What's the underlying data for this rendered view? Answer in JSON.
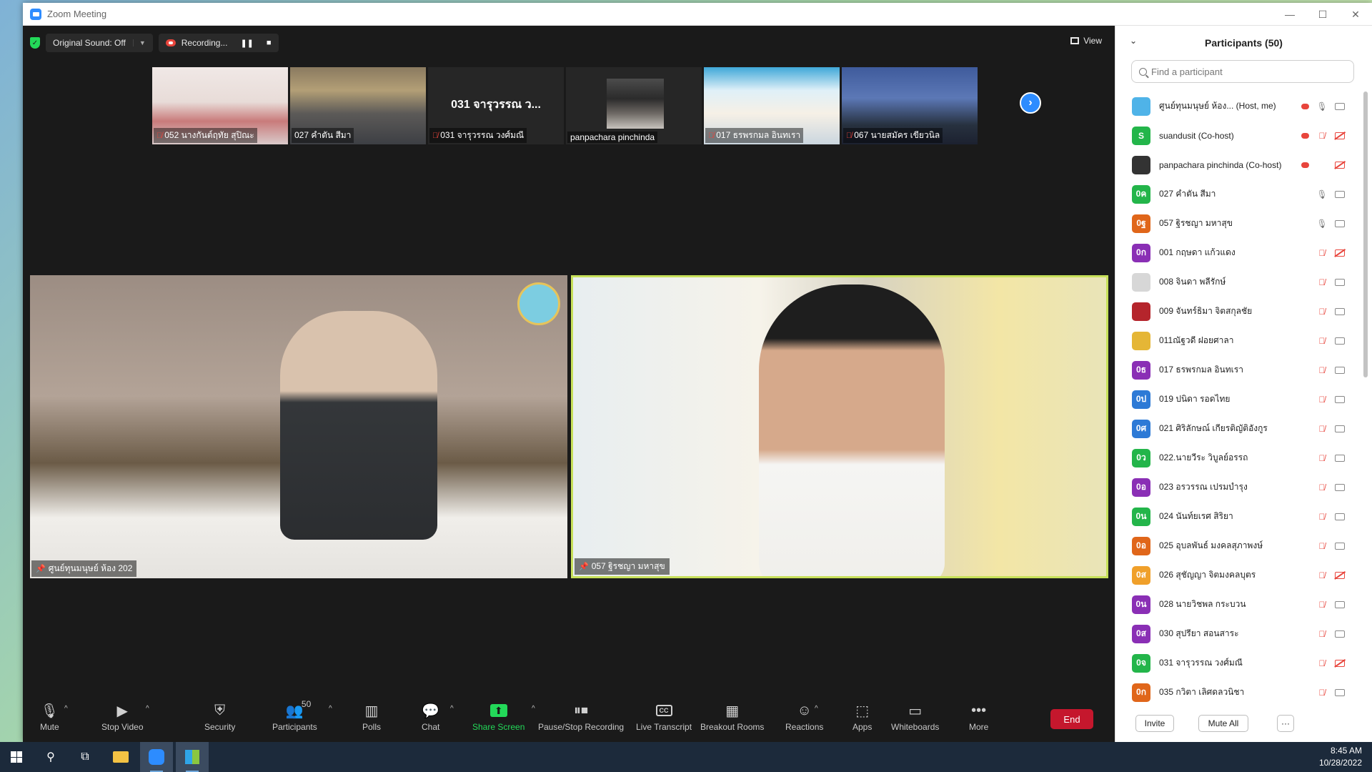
{
  "window": {
    "title": "Zoom Meeting",
    "controls": [
      "—",
      "☐",
      "✕"
    ]
  },
  "top_bar": {
    "original_sound": "Original Sound: Off",
    "recording": "Recording...",
    "pause_icon": "❚❚",
    "stop_icon": "■",
    "view": "View"
  },
  "thumbnails": [
    {
      "name": "052 นางกันต์ฤทัย  สุปิณะ",
      "muted": true
    },
    {
      "name": "027 คำตัน สีมา",
      "muted": false
    },
    {
      "name": "031 จารุวรรณ  วงศ์มณี",
      "muted": true,
      "big_label": "031 จารุวรรณ  ว..."
    },
    {
      "name": "panpachara pinchinda",
      "muted": false
    },
    {
      "name": "017 ธรพรกมล อินทเรา",
      "muted": true
    },
    {
      "name": "067 นายสมัคร  เขียวนิล",
      "muted": true
    }
  ],
  "next_icon": "›",
  "main_videos": [
    {
      "name": "ศูนย์ทุนมนุษย์ ห้อง 202"
    },
    {
      "name": "057 ฐิรชญา มหาสุข"
    }
  ],
  "toolbar": {
    "mute": "Mute",
    "stop_video": "Stop Video",
    "security": "Security",
    "participants": "Participants",
    "participants_count": "50",
    "polls": "Polls",
    "chat": "Chat",
    "share_screen": "Share Screen",
    "pause_stop_recording": "Pause/Stop Recording",
    "live_transcript": "Live Transcript",
    "cc": "CC",
    "breakout_rooms": "Breakout Rooms",
    "reactions": "Reactions",
    "apps": "Apps",
    "whiteboards": "Whiteboards",
    "more": "More",
    "end": "End"
  },
  "panel": {
    "title": "Participants (50)",
    "search_placeholder": "Find a participant",
    "invite": "Invite",
    "mute_all": "Mute All",
    "more": "···",
    "participants": [
      {
        "avatar": "",
        "color": "#4fb3e8",
        "name": "ศูนย์ทุนมนุษย์ ห้อง... (Host, me)",
        "rec": true,
        "mic": "on",
        "cam": "on"
      },
      {
        "avatar": "S",
        "color": "#23b54a",
        "name": "suandusit (Co-host)",
        "rec": true,
        "mic": "off",
        "cam": "off"
      },
      {
        "avatar": "",
        "color": "#333333",
        "name": "panpachara pinchinda (Co-host)",
        "rec": true,
        "mic": "none",
        "cam": "off"
      },
      {
        "avatar": "0ค",
        "color": "#23b54a",
        "name": "027 คำตัน สีมา",
        "rec": false,
        "mic": "on",
        "cam": "on"
      },
      {
        "avatar": "0ฐ",
        "color": "#e0661a",
        "name": "057 ฐิรชญา มหาสุข",
        "rec": false,
        "mic": "on",
        "cam": "on"
      },
      {
        "avatar": "0ก",
        "color": "#8a2fb5",
        "name": "001 กฤษดา  แก้วแดง",
        "rec": false,
        "mic": "off",
        "cam": "off"
      },
      {
        "avatar": "",
        "color": "#d7d7d7",
        "name": "008 จินดา  พลีรักษ์",
        "rec": false,
        "mic": "off",
        "cam": "on"
      },
      {
        "avatar": "",
        "color": "#b5252c",
        "name": "009 จันทร์ธิมา  จิตสกุลชัย",
        "rec": false,
        "mic": "off",
        "cam": "on"
      },
      {
        "avatar": "",
        "color": "#e5b636",
        "name": "011ณัฐวดี ฝอยศาลา",
        "rec": false,
        "mic": "off",
        "cam": "on"
      },
      {
        "avatar": "0ธ",
        "color": "#8a2fb5",
        "name": "017 ธรพรกมล อินทเรา",
        "rec": false,
        "mic": "off",
        "cam": "on"
      },
      {
        "avatar": "0ป",
        "color": "#2d7ad6",
        "name": "019 ปนิดา รอดไทย",
        "rec": false,
        "mic": "off",
        "cam": "on"
      },
      {
        "avatar": "0ศ",
        "color": "#2d7ad6",
        "name": "021 ศิริลักษณ์ เกียรติญัติอังกูร",
        "rec": false,
        "mic": "off",
        "cam": "on"
      },
      {
        "avatar": "0ว",
        "color": "#23b54a",
        "name": "022.นายวีระ  วิบูลย์อรรถ",
        "rec": false,
        "mic": "off",
        "cam": "on"
      },
      {
        "avatar": "0อ",
        "color": "#8a2fb5",
        "name": "023 อรวรรณ  เปรมบำรุง",
        "rec": false,
        "mic": "off",
        "cam": "on"
      },
      {
        "avatar": "0น",
        "color": "#23b54a",
        "name": "024 นันท์ยเรศ  สิริยา",
        "rec": false,
        "mic": "off",
        "cam": "on"
      },
      {
        "avatar": "0อ",
        "color": "#e0661a",
        "name": "025 อุบลพันธ์ มงคลสุภาพงษ์",
        "rec": false,
        "mic": "off",
        "cam": "on"
      },
      {
        "avatar": "0ส",
        "color": "#f0a02a",
        "name": "026 สุชัญญา จิตมงคลบุตร",
        "rec": false,
        "mic": "off",
        "cam": "off"
      },
      {
        "avatar": "0น",
        "color": "#8a2fb5",
        "name": "028 นายวิชพล  กระบวน",
        "rec": false,
        "mic": "off",
        "cam": "on"
      },
      {
        "avatar": "0ส",
        "color": "#8a2fb5",
        "name": "030 สุปรียา สอนสาระ",
        "rec": false,
        "mic": "off",
        "cam": "on"
      },
      {
        "avatar": "0จ",
        "color": "#23b54a",
        "name": "031 จารุวรรณ  วงศ์มณี",
        "rec": false,
        "mic": "off",
        "cam": "off"
      },
      {
        "avatar": "0ก",
        "color": "#e0661a",
        "name": "035 กวิตา  เลิศดลวนิชา",
        "rec": false,
        "mic": "off",
        "cam": "on"
      }
    ]
  },
  "taskbar": {
    "time": "8:45 AM",
    "date": "10/28/2022"
  }
}
